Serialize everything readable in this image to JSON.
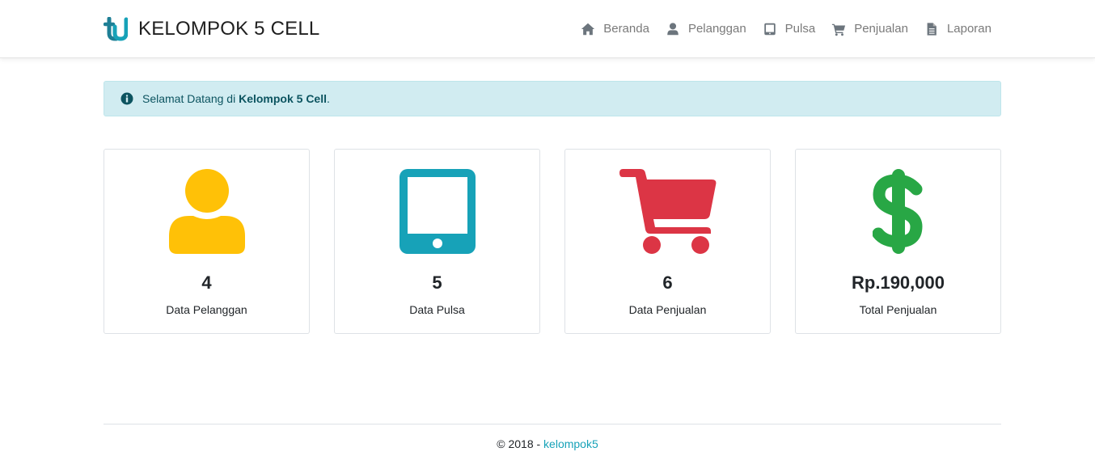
{
  "brand": {
    "name": "KELOMPOK 5 CELL",
    "logo_icon": "tu-logo-icon",
    "logo_color": "#17a2b8"
  },
  "nav": {
    "items": [
      {
        "label": "Beranda",
        "icon": "home-icon"
      },
      {
        "label": "Pelanggan",
        "icon": "user-icon"
      },
      {
        "label": "Pulsa",
        "icon": "tablet-icon"
      },
      {
        "label": "Penjualan",
        "icon": "cart-icon"
      },
      {
        "label": "Laporan",
        "icon": "file-icon"
      }
    ],
    "color": "#7a7a7a"
  },
  "alert": {
    "icon": "info-circle-icon",
    "prefix": "Selamat Datang di ",
    "emphasis": "Kelompok 5 Cell",
    "suffix": ".",
    "background": "#d1ecf1",
    "text_color": "#0c5460"
  },
  "cards": [
    {
      "icon": "user-icon",
      "color": "#ffc107",
      "value": "4",
      "label": "Data Pelanggan"
    },
    {
      "icon": "tablet-icon",
      "color": "#17a2b8",
      "value": "5",
      "label": "Data Pulsa"
    },
    {
      "icon": "cart-icon",
      "color": "#dc3545",
      "value": "6",
      "label": "Data Penjualan"
    },
    {
      "icon": "dollar-icon",
      "color": "#28a745",
      "value": "Rp.190,000",
      "label": "Total Penjualan"
    }
  ],
  "footer": {
    "copyright": "© 2018 - ",
    "link": "kelompok5",
    "link_color": "#17a2b8"
  }
}
